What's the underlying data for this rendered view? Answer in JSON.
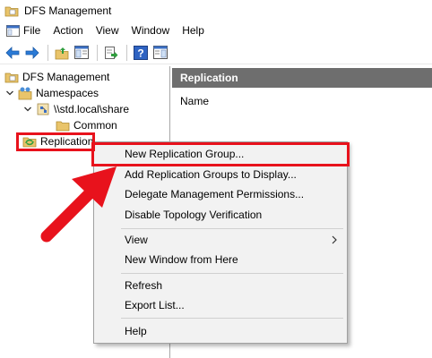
{
  "window": {
    "title": "DFS Management"
  },
  "menu": [
    "File",
    "Action",
    "View",
    "Window",
    "Help"
  ],
  "toolbar": {
    "buttons": [
      "back-arrow-icon",
      "forward-arrow-icon",
      "up-folder-icon",
      "show-hide-tree-icon",
      "export-list-icon",
      "help-icon",
      "show-hide-action-pane-icon"
    ]
  },
  "tree": {
    "root": "DFS Management",
    "namespaces": "Namespaces",
    "share": "\\\\std.local\\share",
    "common": "Common",
    "replication": "Replication"
  },
  "right_pane": {
    "header": "Replication",
    "column_name": "Name"
  },
  "context_menu": {
    "items": [
      "New Replication Group...",
      "Add Replication Groups to Display...",
      "Delegate Management Permissions...",
      "Disable Topology Verification",
      "View",
      "New Window from Here",
      "Refresh",
      "Export List...",
      "Help"
    ]
  },
  "colors": {
    "annotation_red": "#e8121c",
    "pane_header": "#6e6e6e"
  }
}
